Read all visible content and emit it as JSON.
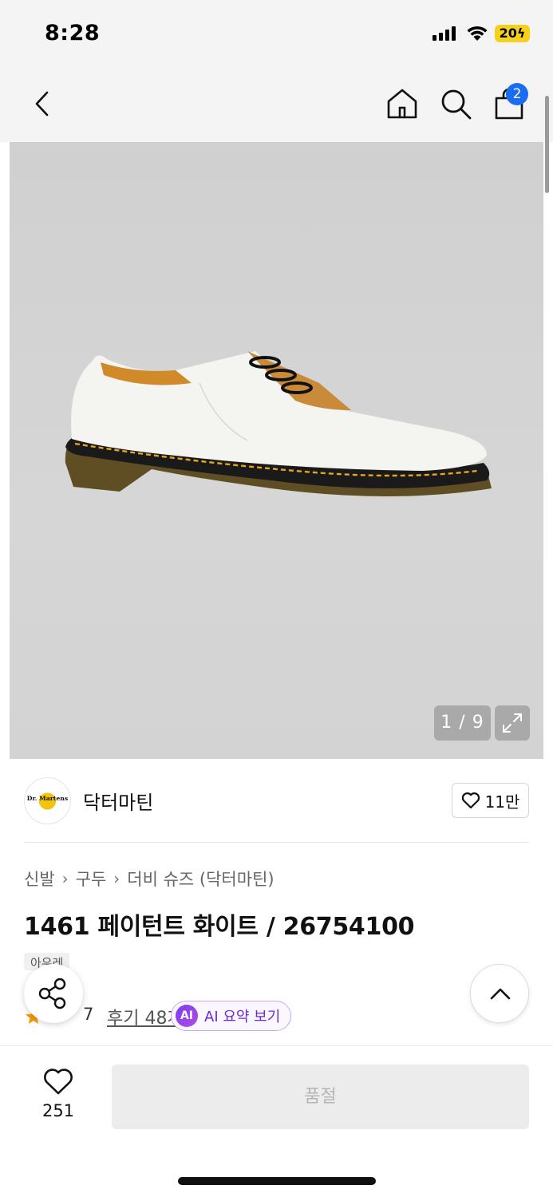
{
  "status_bar": {
    "time": "8:28",
    "battery": "20"
  },
  "nav": {
    "back_icon": "chevron-left-icon",
    "home_icon": "home-icon",
    "search_icon": "search-icon",
    "cart_icon": "shopping-bag-icon",
    "cart_count": "2"
  },
  "gallery": {
    "counter": "1 / 9",
    "expand_icon": "expand-icon"
  },
  "brand": {
    "name": "닥터마틴",
    "logo_text": "Dr. Martens",
    "like_count": "11만"
  },
  "breadcrumb": [
    "신발",
    "구두",
    "더비 슈즈 (닥터마틴)"
  ],
  "product": {
    "title": "1461 페이턴트 화이트 / 26754100",
    "tag": "아우레"
  },
  "reviews": {
    "score": "7",
    "link_text": "후기 48개",
    "ai_chip": "AI",
    "ai_label": "AI 요약 보기"
  },
  "bottom_bar": {
    "wish_count": "251",
    "buy_label": "품절"
  },
  "colors": {
    "accent_blue": "#1a6cf0",
    "ai_purple": "#7a3cf0",
    "star_orange": "#f59a0c"
  }
}
